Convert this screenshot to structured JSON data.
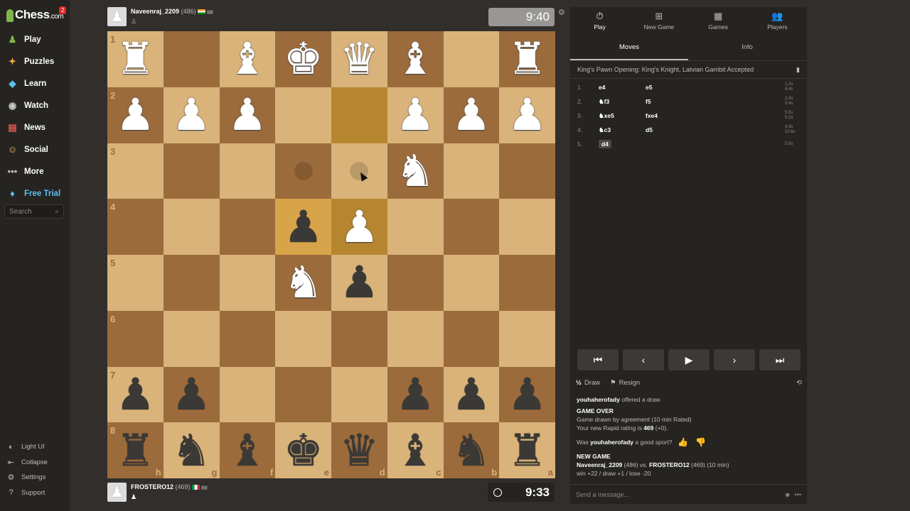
{
  "sidebar": {
    "brand": "Chess",
    "brand_suffix": ".com",
    "notification_count": "2",
    "nav": [
      {
        "label": "Play",
        "icon": "play-icon"
      },
      {
        "label": "Puzzles",
        "icon": "puzzle-icon"
      },
      {
        "label": "Learn",
        "icon": "learn-icon"
      },
      {
        "label": "Watch",
        "icon": "watch-icon"
      },
      {
        "label": "News",
        "icon": "news-icon"
      },
      {
        "label": "Social",
        "icon": "social-icon"
      },
      {
        "label": "More",
        "icon": "more-icon"
      },
      {
        "label": "Free Trial",
        "icon": "diamond-icon"
      }
    ],
    "search_placeholder": "Search",
    "bottom": [
      {
        "label": "Light UI",
        "icon": "light-ui-icon"
      },
      {
        "label": "Collapse",
        "icon": "collapse-icon"
      },
      {
        "label": "Settings",
        "icon": "gear-icon"
      },
      {
        "label": "Support",
        "icon": "help-icon"
      }
    ]
  },
  "top_player": {
    "name": "Naveenraj_2209",
    "rating": "(486)",
    "clock": "9:40",
    "flag_color": "#ff9933"
  },
  "bottom_player": {
    "name": "FROSTERO12",
    "rating": "(469)",
    "clock": "9:33",
    "flag_color": "#009246"
  },
  "board": {
    "ranks": [
      "1",
      "2",
      "3",
      "4",
      "5",
      "6",
      "7",
      "8"
    ],
    "files": [
      "h",
      "g",
      "f",
      "e",
      "d",
      "c",
      "b",
      "a"
    ],
    "rows": [
      [
        "wR",
        "",
        "wB",
        "wK",
        "wQ",
        "wB",
        "",
        "wR"
      ],
      [
        "wP",
        "wP",
        "wP",
        "",
        "",
        "wP",
        "wP",
        "wP"
      ],
      [
        "",
        "",
        "",
        "",
        "",
        "wN",
        "",
        ""
      ],
      [
        "",
        "",
        "",
        "bP",
        "wP",
        "",
        "",
        ""
      ],
      [
        "",
        "",
        "",
        "wN",
        "bP",
        "",
        "",
        ""
      ],
      [
        "",
        "",
        "",
        "",
        "",
        "",
        "",
        ""
      ],
      [
        "bP",
        "bP",
        "",
        "",
        "",
        "bP",
        "bP",
        "bP"
      ],
      [
        "bR",
        "bN",
        "bB",
        "bK",
        "bQ",
        "bB",
        "bN",
        "bR"
      ]
    ],
    "highlights": [
      [
        1,
        4
      ],
      [
        3,
        3
      ],
      [
        3,
        4
      ]
    ],
    "hints": [
      [
        2,
        3
      ],
      [
        2,
        4
      ]
    ]
  },
  "panel": {
    "tabs": [
      {
        "label": "Play",
        "icon": "stopwatch-icon"
      },
      {
        "label": "New Game",
        "icon": "plus-icon"
      },
      {
        "label": "Games",
        "icon": "board-icon"
      },
      {
        "label": "Players",
        "icon": "players-icon"
      }
    ],
    "subtabs": [
      "Moves",
      "Info"
    ],
    "opening": "King's Pawn Opening: King's Knight, Latvian Gambit Accepted",
    "moves": [
      {
        "num": "1.",
        "white": "e4",
        "white_piece": "",
        "black": "e5",
        "times": [
          "1.2s",
          "4.4s"
        ]
      },
      {
        "num": "2.",
        "white": "f3",
        "white_piece": "♞",
        "black": "f5",
        "times": [
          "2.3s",
          "3.4s"
        ]
      },
      {
        "num": "3.",
        "white": "xe5",
        "white_piece": "♞",
        "black": "fxe4",
        "times": [
          "5.5s",
          "5.2s"
        ]
      },
      {
        "num": "4.",
        "white": "c3",
        "white_piece": "♞",
        "black": "d5",
        "times": [
          "4.3s",
          "10.6s"
        ]
      },
      {
        "num": "5.",
        "white": "d4",
        "white_piece": "",
        "black": "",
        "times": [
          "5.5s",
          ""
        ]
      }
    ],
    "controls": [
      "⏮",
      "‹",
      "▶",
      "›",
      "⏭"
    ],
    "draw_label": "Draw",
    "draw_fraction": "½",
    "resign_label": "Resign",
    "chat": {
      "offer_user": "youhaherofady",
      "offer_text": "offered a draw",
      "game_over": "GAME OVER",
      "game_result": "Game drawn by agreement (10 min Rated)",
      "rating_line_prefix": "Your new Rapid rating is",
      "rating_value": "469",
      "rating_delta": "(+0).",
      "sport_prefix": "Was",
      "sport_user": "youhaherofady",
      "sport_suffix": "a good sport?",
      "new_game": "NEW GAME",
      "ng_white": "Naveenraj_2209",
      "ng_white_rating": "(486) vs.",
      "ng_black": "FROSTERO12",
      "ng_black_rating": "(469) (10 min)",
      "ng_stakes": "win +22 / draw +1 / lose -20"
    },
    "message_placeholder": "Send a message..."
  }
}
